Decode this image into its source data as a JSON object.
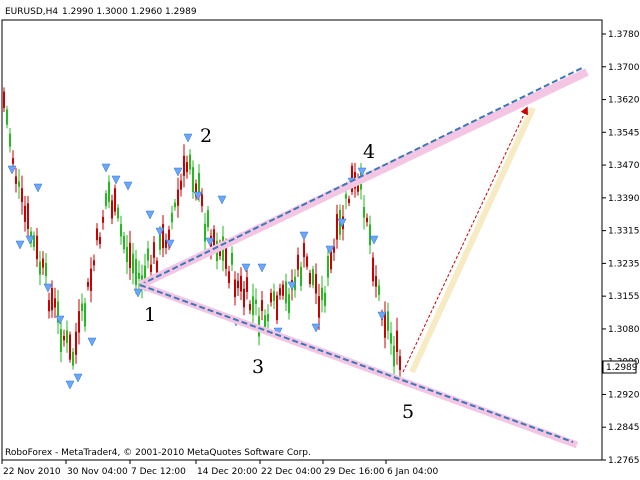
{
  "header": {
    "symbol": "EURUSD,H4",
    "ohlc": "1.2990 1.3000 1.2960 1.2989"
  },
  "footer": {
    "copyright": "RoboForex - MetaTrader4, © 2001-2010 MetaQuotes Software Corp."
  },
  "current_price": "1.2989",
  "wave_labels": [
    "1",
    "2",
    "3",
    "4",
    "5"
  ],
  "colors": {
    "bull_candle": "#22bb22",
    "bear_candle": "#cc0000",
    "fractal_arrow": "#6aa8ff",
    "trend_line": "#3b78b8",
    "target_arrow": "#cc0000",
    "price_tag": "#ffffff"
  },
  "chart_data": {
    "type": "candlestick",
    "y_ticks": [
      "1.3780",
      "1.3700",
      "1.3620",
      "1.3545",
      "1.3470",
      "1.3390",
      "1.3315",
      "1.3235",
      "1.3155",
      "1.3080",
      "1.3000",
      "1.2920",
      "1.2845",
      "1.2765"
    ],
    "ylim": [
      1.2765,
      1.378
    ],
    "x_ticks": [
      "22 Nov 2010",
      "30 Nov 04:00",
      "7 Dec 12:00",
      "14 Dec 20:00",
      "22 Dec 04:00",
      "29 Dec 16:00",
      "6 Jan 04:00"
    ],
    "pattern": {
      "point_1": 1.3185,
      "point_2": 1.3495,
      "point_3": 1.3045,
      "point_4": 1.344,
      "point_5": 1.2965,
      "upper_line": [
        1.3185,
        1.37
      ],
      "lower_line": [
        1.3185,
        1.279
      ],
      "target": 1.36
    }
  }
}
